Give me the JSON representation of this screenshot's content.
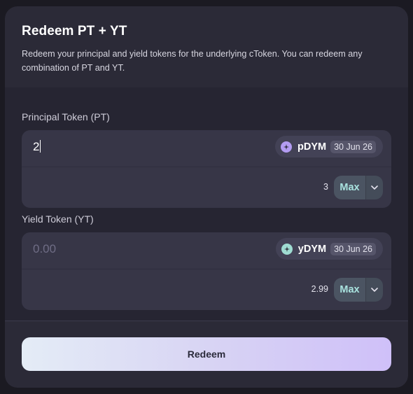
{
  "header": {
    "title": "Redeem PT + YT",
    "subtitle": "Redeem your principal and yield tokens for the underlying cToken. You can redeem any combination of PT and YT."
  },
  "principal": {
    "label": "Principal Token (PT)",
    "amount_value": "2",
    "token_name": "pDYM",
    "token_icon": "pt-token-icon",
    "token_color": "#b39cf2",
    "maturity": "30 Jun 26",
    "balance": "3",
    "max_label": "Max"
  },
  "yield": {
    "label": "Yield Token (YT)",
    "amount_placeholder": "0.00",
    "token_name": "yDYM",
    "token_icon": "yt-token-icon",
    "token_color": "#9fdcd2",
    "maturity": "30 Jun 26",
    "balance": "2.99",
    "max_label": "Max"
  },
  "action": {
    "redeem_label": "Redeem"
  }
}
